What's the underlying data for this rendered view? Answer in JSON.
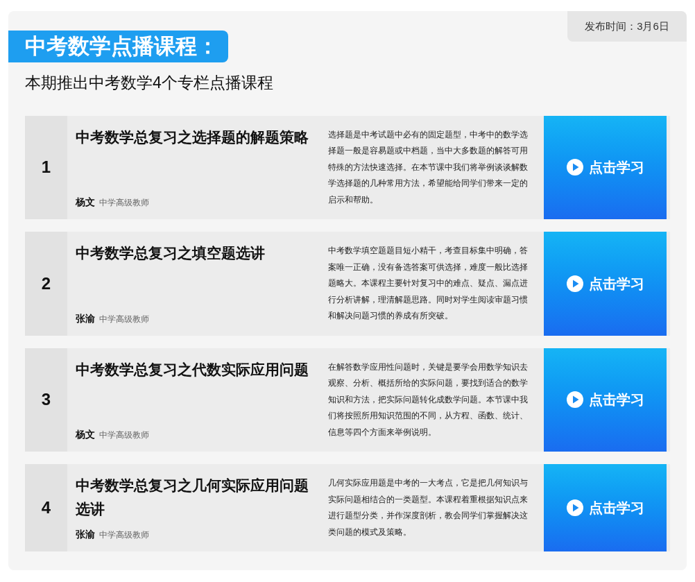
{
  "publish_time": "发布时间：3月6日",
  "heading": "中考数学点播课程：",
  "subtitle": "本期推出中考数学4个专栏点播课程",
  "courses": [
    {
      "number": "1",
      "title": "中考数学总复习之选择题的解题策略",
      "teacher": "杨文",
      "teacher_title": "中学高级教师",
      "description": "选择题是中考试题中必有的固定题型，中考中的数学选择题一般是容易题或中档题，当中大多数题的解答可用特殊的方法快速选择。在本节课中我们将举例谈谈解数学选择题的几种常用方法，希望能给同学们带来一定的启示和帮助。",
      "button": "点击学习"
    },
    {
      "number": "2",
      "title": "中考数学总复习之填空题选讲",
      "teacher": "张渝",
      "teacher_title": "中学高级教师",
      "description": "中考数学填空题题目短小精干，考查目标集中明确，答案唯一正确，没有备选答案可供选择，难度一般比选择题略大。本课程主要针对复习中的难点、疑点、漏点进行分析讲解，理清解题思路。同时对学生阅读审题习惯和解决问题习惯的养成有所突破。",
      "button": "点击学习"
    },
    {
      "number": "3",
      "title": "中考数学总复习之代数实际应用问题",
      "teacher": "杨文",
      "teacher_title": "中学高级教师",
      "description": "在解答数学应用性问题时，关键是要学会用数学知识去观察、分析、概括所给的实际问题，要找到适合的数学知识和方法，把实际问题转化成数学问题。本节课中我们将按照所用知识范围的不同，从方程、函数、统计、信息等四个方面来举例说明。",
      "button": "点击学习"
    },
    {
      "number": "4",
      "title": "中考数学总复习之几何实际应用问题选讲",
      "teacher": "张渝",
      "teacher_title": "中学高级教师",
      "description": "几何实际应用题是中考的一大考点，它是把几何知识与实际问题相结合的一类题型。本课程着重根据知识点来进行题型分类，并作深度剖析，教会同学们掌握解决这类问题的模式及策略。",
      "button": "点击学习"
    }
  ]
}
